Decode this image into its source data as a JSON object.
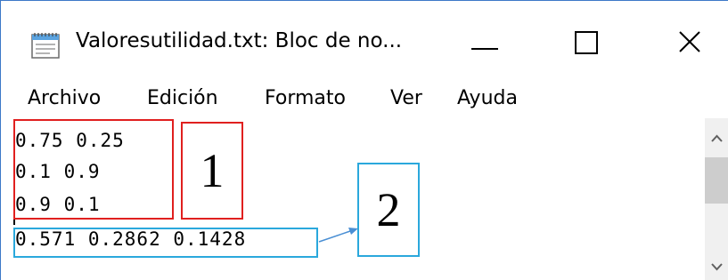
{
  "window": {
    "title": "Valoresutilidad.txt: Bloc de no...",
    "minimize_glyph": "—",
    "maximize_glyph": "☐",
    "close_glyph": "✕"
  },
  "menu": {
    "items": [
      {
        "label": "Archivo"
      },
      {
        "label": "Edición"
      },
      {
        "label": "Formato"
      },
      {
        "label": "Ver"
      },
      {
        "label": "Ayuda"
      }
    ]
  },
  "editor": {
    "lines": [
      "0.75 0.25",
      "0.1 0.9",
      "0.9 0.1",
      "0.571 0.2862 0.1428"
    ]
  },
  "annotations": {
    "label_1": "1",
    "label_2": "2",
    "colors": {
      "box_1": "#e0201f",
      "box_2": "#2aa8dc",
      "arrow": "#4a8fd4"
    }
  },
  "icons": {
    "app": "notepad-icon",
    "scroll_up": "scroll-up-arrow-icon",
    "scroll_down": "scroll-down-arrow-icon"
  }
}
